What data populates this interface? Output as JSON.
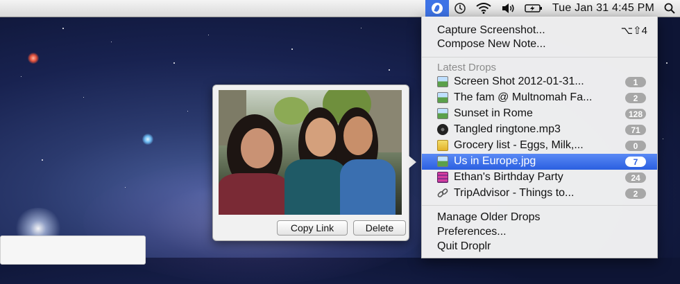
{
  "menubar": {
    "app_icon": "droplr-icon",
    "status_icons": [
      "time-machine-icon",
      "wifi-icon",
      "volume-icon",
      "battery-icon"
    ],
    "clock": "Tue Jan 31  4:45 PM",
    "spotlight_icon": "magnifier-icon"
  },
  "menu": {
    "capture_label": "Capture Screenshot...",
    "capture_shortcut": "⌥⇧4",
    "compose_label": "Compose New Note...",
    "section_title": "Latest Drops",
    "drops": [
      {
        "label": "Screen Shot 2012-01-31...",
        "count": "1",
        "icon": "image-icon"
      },
      {
        "label": "The fam @ Multnomah Fa...",
        "count": "2",
        "icon": "image-icon"
      },
      {
        "label": "Sunset in Rome",
        "count": "128",
        "icon": "image-icon"
      },
      {
        "label": "Tangled ringtone.mp3",
        "count": "71",
        "icon": "audio-icon"
      },
      {
        "label": "Grocery list - Eggs, Milk,...",
        "count": "0",
        "icon": "note-icon"
      },
      {
        "label": "Us in Europe.jpg",
        "count": "7",
        "icon": "image-icon",
        "selected": true
      },
      {
        "label": "Ethan's Birthday Party",
        "count": "24",
        "icon": "movie-icon"
      },
      {
        "label": "TripAdvisor - Things to...",
        "count": "2",
        "icon": "link-icon"
      }
    ],
    "manage_label": "Manage Older Drops",
    "preferences_label": "Preferences...",
    "quit_label": "Quit Droplr"
  },
  "preview": {
    "copy_link_label": "Copy Link",
    "delete_label": "Delete"
  },
  "colors": {
    "selection": "#2b5fe0",
    "badge": "#a7a7a7",
    "menubar_accent": "#3e73e6"
  }
}
